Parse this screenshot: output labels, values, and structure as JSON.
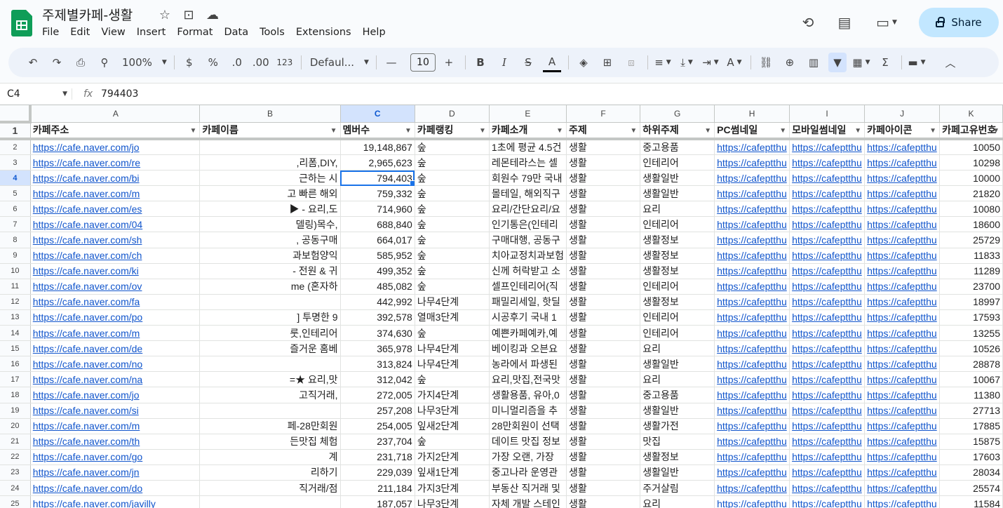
{
  "title": "주제별카페-생활",
  "menu": [
    "File",
    "Edit",
    "View",
    "Insert",
    "Format",
    "Data",
    "Tools",
    "Extensions",
    "Help"
  ],
  "share_label": "Share",
  "toolbar": {
    "zoom": "100%",
    "currency": "$",
    "percent": "%",
    "dec_less": ".0",
    "dec_more": ".00",
    "format_123": "123",
    "font": "Defaul...",
    "font_size": "10",
    "bold": "B",
    "italic": "I",
    "strike": "S",
    "text_color": "A"
  },
  "formula": {
    "cell_ref": "C4",
    "fx": "fx",
    "value": "794403"
  },
  "columns": [
    "A",
    "B",
    "C",
    "D",
    "E",
    "F",
    "G",
    "H",
    "I",
    "J",
    "K"
  ],
  "headers": [
    "카페주소",
    "카페이름",
    "멤버수",
    "카페랭킹",
    "카페소개",
    "주제",
    "하위주제",
    "PC썸네일",
    "모바일썸네일",
    "카페아이콘",
    "카페고유번호"
  ],
  "rows": [
    {
      "n": "2",
      "a": "https://cafe.naver.com/jo",
      "b": "",
      "c": "19,148,867",
      "d": "숲",
      "e": "1초에 평균 4.5건",
      "f": "생활",
      "g": "중고용품",
      "h": "https://cafeptthu",
      "i": "https://cafeptthu",
      "j": "https://cafeptthu",
      "k": "10050"
    },
    {
      "n": "3",
      "a": "https://cafe.naver.com/re",
      "b": ",리폼,DIY,",
      "c": "2,965,623",
      "d": "숲",
      "e": "레몬테라스는 셀",
      "f": "생활",
      "g": "인테리어",
      "h": "https://cafeptthu",
      "i": "https://cafeptthu",
      "j": "https://cafeptthu",
      "k": "10298"
    },
    {
      "n": "4",
      "a": "https://cafe.naver.com/bi",
      "b": "근하는 시",
      "c": "794,403",
      "d": "숲",
      "e": "회원수 79만 국내",
      "f": "생활",
      "g": "생활일반",
      "h": "https://cafeptthu",
      "i": "https://cafeptthu",
      "j": "https://cafeptthu",
      "k": "10000"
    },
    {
      "n": "5",
      "a": "https://cafe.naver.com/m",
      "b": "고 빠른 해외",
      "c": "759,332",
      "d": "숲",
      "e": "몰테일, 해외직구",
      "f": "생활",
      "g": "생활일반",
      "h": "https://cafeptthu",
      "i": "https://cafeptthu",
      "j": "https://cafeptthu",
      "k": "21820"
    },
    {
      "n": "6",
      "a": "https://cafe.naver.com/es",
      "b": "▶ - 요리,도",
      "c": "714,960",
      "d": "숲",
      "e": "요리/간단요리/요",
      "f": "생활",
      "g": "요리",
      "h": "https://cafeptthu",
      "i": "https://cafeptthu",
      "j": "https://cafeptthu",
      "k": "10080"
    },
    {
      "n": "7",
      "a": "https://cafe.naver.com/04",
      "b": "델링)목수,",
      "c": "688,840",
      "d": "숲",
      "e": "인기통은(인테리",
      "f": "생활",
      "g": "인테리어",
      "h": "https://cafeptthu",
      "i": "https://cafeptthu",
      "j": "https://cafeptthu",
      "k": "18600"
    },
    {
      "n": "8",
      "a": "https://cafe.naver.com/sh",
      "b": ", 공동구매",
      "c": "664,017",
      "d": "숲",
      "e": "구매대행, 공동구",
      "f": "생활",
      "g": "생활정보",
      "h": "https://cafeptthu",
      "i": "https://cafeptthu",
      "j": "https://cafeptthu",
      "k": "25729"
    },
    {
      "n": "9",
      "a": "https://cafe.naver.com/ch",
      "b": "과보험양익",
      "c": "585,952",
      "d": "숲",
      "e": "치아교정치과보험",
      "f": "생활",
      "g": "생활정보",
      "h": "https://cafeptthu",
      "i": "https://cafeptthu",
      "j": "https://cafeptthu",
      "k": "11833"
    },
    {
      "n": "10",
      "a": "https://cafe.naver.com/ki",
      "b": "- 전원 & 귀",
      "c": "499,352",
      "d": "숲",
      "e": "신께 허락받고 소",
      "f": "생활",
      "g": "생활정보",
      "h": "https://cafeptthu",
      "i": "https://cafeptthu",
      "j": "https://cafeptthu",
      "k": "11289"
    },
    {
      "n": "11",
      "a": "https://cafe.naver.com/ov",
      "b": "me (혼자하",
      "c": "485,082",
      "d": "숲",
      "e": "셀프인테리어(직",
      "f": "생활",
      "g": "인테리어",
      "h": "https://cafeptthu",
      "i": "https://cafeptthu",
      "j": "https://cafeptthu",
      "k": "23700"
    },
    {
      "n": "12",
      "a": "https://cafe.naver.com/fa",
      "b": "",
      "c": "442,992",
      "d": "나무4단계",
      "e": "패밀리세일, 핫딜",
      "f": "생활",
      "g": "생활정보",
      "h": "https://cafeptthu",
      "i": "https://cafeptthu",
      "j": "https://cafeptthu",
      "k": "18997"
    },
    {
      "n": "13",
      "a": "https://cafe.naver.com/po",
      "b": "] 투명한 9",
      "c": "392,578",
      "d": "열매3단계",
      "e": "시공후기 국내 1",
      "f": "생활",
      "g": "인테리어",
      "h": "https://cafeptthu",
      "i": "https://cafeptthu",
      "j": "https://cafeptthu",
      "k": "17593"
    },
    {
      "n": "14",
      "a": "https://cafe.naver.com/m",
      "b": "룻,인테리어",
      "c": "374,630",
      "d": "숲",
      "e": "예쁜카페예카,예",
      "f": "생활",
      "g": "인테리어",
      "h": "https://cafeptthu",
      "i": "https://cafeptthu",
      "j": "https://cafeptthu",
      "k": "13255"
    },
    {
      "n": "15",
      "a": "https://cafe.naver.com/de",
      "b": "즐거운 홈베",
      "c": "365,978",
      "d": "나무4단계",
      "e": "베이킹과 오븐요",
      "f": "생활",
      "g": "요리",
      "h": "https://cafeptthu",
      "i": "https://cafeptthu",
      "j": "https://cafeptthu",
      "k": "10526"
    },
    {
      "n": "16",
      "a": "https://cafe.naver.com/no",
      "b": "",
      "c": "313,824",
      "d": "나무4단계",
      "e": "농라에서 파생된",
      "f": "생활",
      "g": "생활일반",
      "h": "https://cafeptthu",
      "i": "https://cafeptthu",
      "j": "https://cafeptthu",
      "k": "28878"
    },
    {
      "n": "17",
      "a": "https://cafe.naver.com/na",
      "b": "=★ 요리,맛",
      "c": "312,042",
      "d": "숲",
      "e": "요리,맛집,전국맛",
      "f": "생활",
      "g": "요리",
      "h": "https://cafeptthu",
      "i": "https://cafeptthu",
      "j": "https://cafeptthu",
      "k": "10067"
    },
    {
      "n": "18",
      "a": "https://cafe.naver.com/jo",
      "b": "고직거래,",
      "c": "272,005",
      "d": "가지4단계",
      "e": "생활용품, 유아,0",
      "f": "생활",
      "g": "중고용품",
      "h": "https://cafeptthu",
      "i": "https://cafeptthu",
      "j": "https://cafeptthu",
      "k": "11380"
    },
    {
      "n": "19",
      "a": "https://cafe.naver.com/si",
      "b": "",
      "c": "257,208",
      "d": "나무3단계",
      "e": "미니멀리즘을 추",
      "f": "생활",
      "g": "생활일반",
      "h": "https://cafeptthu",
      "i": "https://cafeptthu",
      "j": "https://cafeptthu",
      "k": "27713"
    },
    {
      "n": "20",
      "a": "https://cafe.naver.com/m",
      "b": "페-28만회원",
      "c": "254,005",
      "d": "잎새2단계",
      "e": "28만회원이 선택",
      "f": "생활",
      "g": "생활가전",
      "h": "https://cafeptthu",
      "i": "https://cafeptthu",
      "j": "https://cafeptthu",
      "k": "17885"
    },
    {
      "n": "21",
      "a": "https://cafe.naver.com/th",
      "b": "든맛집 체험",
      "c": "237,704",
      "d": "숲",
      "e": "데이트 맛집 정보",
      "f": "생활",
      "g": "맛집",
      "h": "https://cafeptthu",
      "i": "https://cafeptthu",
      "j": "https://cafeptthu",
      "k": "15875"
    },
    {
      "n": "22",
      "a": "https://cafe.naver.com/go",
      "b": "계",
      "c": "231,718",
      "d": "가지2단계",
      "e": "가장 오랜, 가장",
      "f": "생활",
      "g": "생활정보",
      "h": "https://cafeptthu",
      "i": "https://cafeptthu",
      "j": "https://cafeptthu",
      "k": "17603"
    },
    {
      "n": "23",
      "a": "https://cafe.naver.com/jn",
      "b": "리하기",
      "c": "229,039",
      "d": "잎새1단계",
      "e": "중고나라 운영관",
      "f": "생활",
      "g": "생활일반",
      "h": "https://cafeptthu",
      "i": "https://cafeptthu",
      "j": "https://cafeptthu",
      "k": "28034"
    },
    {
      "n": "24",
      "a": "https://cafe.naver.com/do",
      "b": "직거래/점",
      "c": "211,184",
      "d": "가지3단계",
      "e": "부동산 직거래 및",
      "f": "생활",
      "g": "주거살림",
      "h": "https://cafeptthu",
      "i": "https://cafeptthu",
      "j": "https://cafeptthu",
      "k": "25574"
    },
    {
      "n": "25",
      "a": "https://cafe.naver.com/javilly",
      "b": "",
      "c": "187,057",
      "d": "나무3단계",
      "e": "자체 개발 스테인",
      "f": "생활",
      "g": "요리",
      "h": "https://cafeptthu",
      "i": "https://cafeptthu",
      "j": "https://cafeptthu",
      "k": "11584"
    }
  ]
}
